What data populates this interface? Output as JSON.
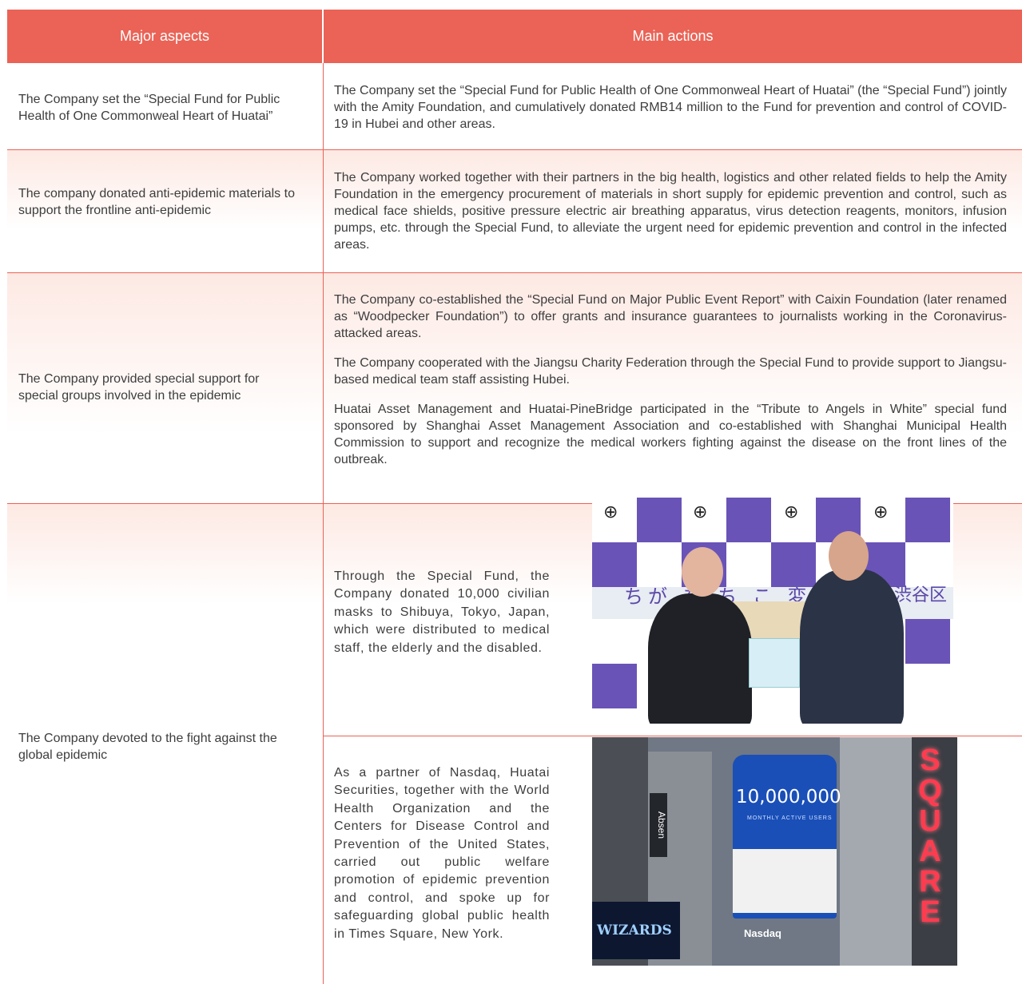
{
  "header": {
    "col1": "Major aspects",
    "col2": "Main actions"
  },
  "rows": [
    {
      "aspect": "The Company set the “Special Fund for Public Health of One Commonweal Heart of Huatai”",
      "actions": [
        "The Company set the “Special Fund for Public Health of One Commonweal Heart of Huatai” (the “Special Fund”) jointly with the Amity Foundation, and cumulatively donated RMB14 million to the Fund for prevention and control of COVID-19 in Hubei and other areas."
      ]
    },
    {
      "aspect": "The company donated anti-epidemic materials to support the frontline anti-epidemic",
      "actions": [
        "The Company worked together with their partners in the big health, logistics and other related fields to help the Amity Foundation in the emergency procurement of materials in short supply for epidemic prevention and control, such as medical face shields, positive pressure electric air breathing apparatus, virus detection reagents, monitors, infusion pumps, etc. through the Special Fund, to alleviate the urgent need for epidemic prevention and control in the infected areas."
      ]
    },
    {
      "aspect": "The Company provided special support for special groups involved in the epidemic",
      "actions": [
        "The Company co-established the “Special Fund on Major Public Event Report” with Caixin Foundation (later renamed as “Woodpecker Foundation”) to offer grants and insurance guarantees to journalists working in the Coronavirus-attacked areas.",
        "The Company cooperated with the Jiangsu Charity Federation through the Special Fund to provide support to Jiangsu-based medical team staff assisting Hubei.",
        "Huatai Asset Management and Huatai-PineBridge participated in the “Tribute to Angels in White” special fund sponsored by Shanghai Asset Management Association and co-established with Shanghai Municipal Health Commission to support and recognize the medical workers fighting against the disease on the front lines of the outbreak."
      ]
    },
    {
      "aspect": "The Company devoted to the fight against the global epidemic",
      "items": [
        {
          "caption": "Through the Special Fund, the Company donated 10,000 civilian masks to Shibuya, Tokyo, Japan, which were distributed to medical staff, the elderly and the disabled.",
          "photo_text": "渋谷区"
        },
        {
          "caption": "As a partner of Nasdaq, Huatai Securities, together with the World Health Organization and the Centers for Disease Control and Prevention of the United States, carried out public welfare promotion of epidemic prevention and control, and spoke up for safeguarding global public health in Times Square, New York.",
          "photo_text": "Nasdaq"
        }
      ]
    }
  ],
  "colors": {
    "accent": "#ea6356",
    "band": "#fde9e3"
  }
}
